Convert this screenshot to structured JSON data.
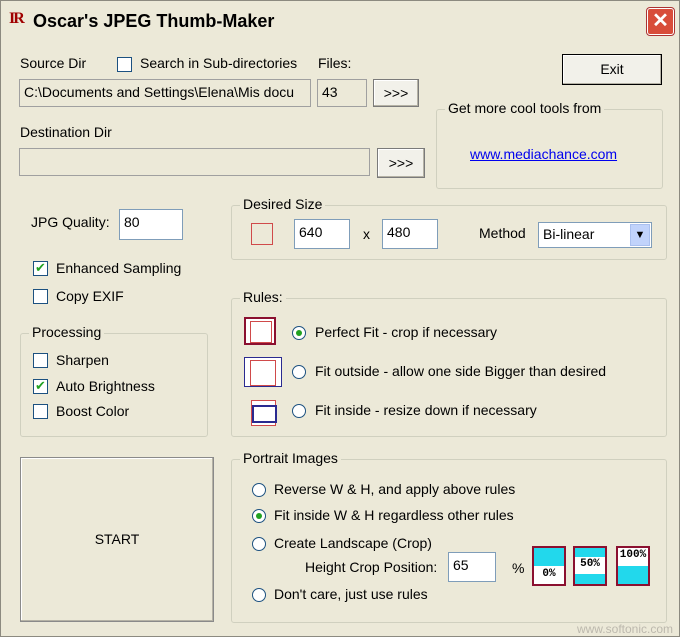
{
  "window": {
    "title": "Oscar's JPEG Thumb-Maker",
    "icon_text": "IR",
    "close_symbol": "✕"
  },
  "source": {
    "label": "Source Dir",
    "search_subdirs_label": "Search in Sub-directories",
    "search_subdirs_checked": false,
    "path_value": "C:\\Documents and Settings\\Elena\\Mis docu",
    "files_label": "Files:",
    "files_count": "43",
    "browse_label": ">>>"
  },
  "destination": {
    "label": "Destination Dir",
    "path_value": "",
    "browse_label": ">>>"
  },
  "exit_label": "Exit",
  "promo": {
    "title": "Get more cool tools from",
    "link_text": "www.mediachance.com"
  },
  "jpg_quality": {
    "label": "JPG Quality:",
    "value": "80"
  },
  "enhanced_sampling": {
    "label": "Enhanced Sampling",
    "checked": true
  },
  "copy_exif": {
    "label": "Copy EXIF",
    "checked": false
  },
  "processing": {
    "title": "Processing",
    "sharpen": {
      "label": "Sharpen",
      "checked": false
    },
    "auto_brightness": {
      "label": "Auto Brightness",
      "checked": true
    },
    "boost_color": {
      "label": "Boost Color",
      "checked": false
    }
  },
  "desired_size": {
    "title": "Desired Size",
    "width": "640",
    "x_label": "x",
    "height": "480",
    "method_label": "Method",
    "method_value": "Bi-linear"
  },
  "rules": {
    "title": "Rules:",
    "options": [
      {
        "label": "Perfect Fit - crop if necessary",
        "selected": true
      },
      {
        "label": "Fit outside - allow one side Bigger than desired",
        "selected": false
      },
      {
        "label": "Fit inside - resize down if necessary",
        "selected": false
      }
    ]
  },
  "portrait": {
    "title": "Portrait Images",
    "options": [
      {
        "label": "Reverse W & H, and apply above rules",
        "selected": false
      },
      {
        "label": "Fit inside W & H regardless other rules",
        "selected": true
      },
      {
        "label": "Create Landscape (Crop)",
        "selected": false
      },
      {
        "label": "Don't care, just use rules",
        "selected": false
      }
    ],
    "height_crop_label": "Height Crop Position:",
    "height_crop_value": "65",
    "percent_label": "%",
    "presets": [
      "0%",
      "50%",
      "100%"
    ]
  },
  "start_label": "START",
  "watermark": "www.softonic.com",
  "colors": {
    "accent_cyan": "#22d8ec",
    "icon_border": "#8b1030",
    "link": "#0000ee"
  }
}
